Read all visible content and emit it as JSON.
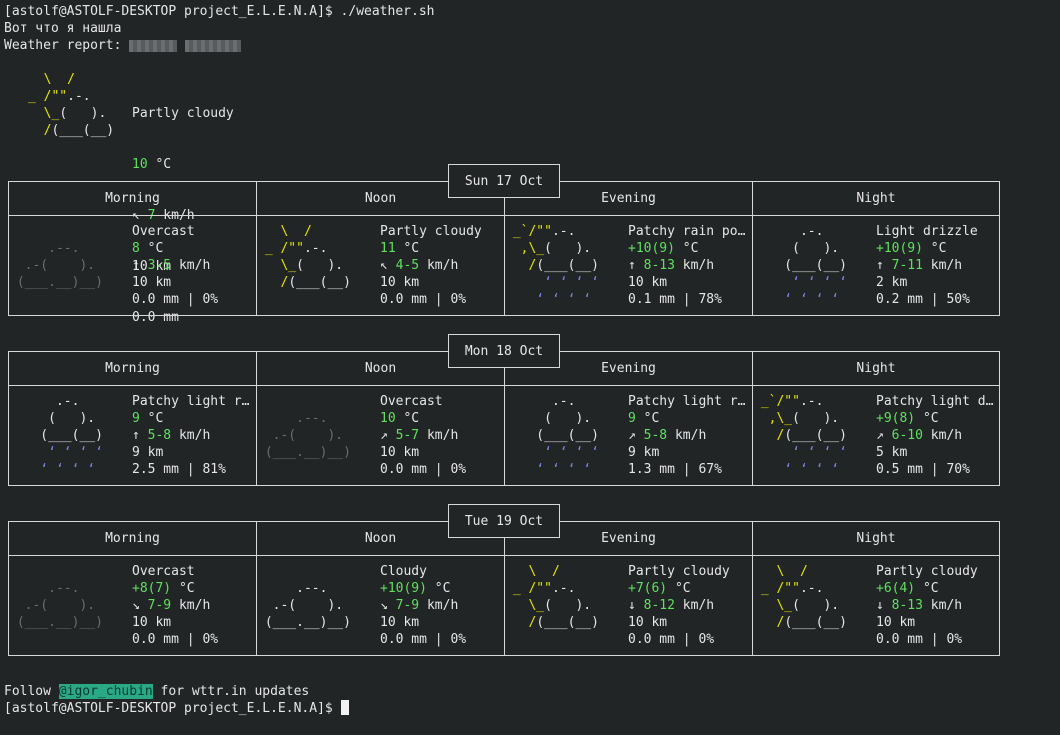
{
  "terminal": {
    "prompt_cmd": "[astolf@ASTOLF-DESKTOP project_E.L.E.N.A]$ ./weather.sh",
    "greeting": "Вот что я нашла",
    "report_label": "Weather report: ",
    "footer_prefix": "Follow ",
    "footer_handle": "@igor_chubin",
    "footer_suffix": " for wttr.in updates",
    "prompt_end": "[astolf@ASTOLF-DESKTOP project_E.L.E.N.A]$ "
  },
  "current": {
    "condition": "Partly cloudy",
    "temp": "10",
    "unit": " °C",
    "wind_dir": "↖",
    "wind": "7",
    "wind_unit": " km/h",
    "visibility": "10 km",
    "precip": "0.0 mm",
    "art": [
      "  \\  /      ",
      "_ /\"\".-.    ",
      "  \\_(   ).  ",
      "  /(___(__) "
    ]
  },
  "periods": [
    "Morning",
    "Noon",
    "Evening",
    "Night"
  ],
  "days": [
    {
      "label": "Sun 17 Oct",
      "forecasts": [
        {
          "condition": "Overcast",
          "temp": "8",
          "wind_dir": "↑",
          "wind": "3-5",
          "visibility": "10 km",
          "precip": "0.0 mm | 0%",
          "art_type": "overcast"
        },
        {
          "condition": "Partly cloudy",
          "temp": "11",
          "wind_dir": "↖",
          "wind": "4-5",
          "visibility": "10 km",
          "precip": "0.0 mm | 0%",
          "art_type": "partly"
        },
        {
          "condition": "Patchy rain po…",
          "temp": "+10(9)",
          "wind_dir": "↑",
          "wind": "8-13",
          "visibility": "10 km",
          "precip": "0.1 mm | 78%",
          "art_type": "patchyrain"
        },
        {
          "condition": "Light drizzle",
          "temp": "+10(9)",
          "wind_dir": "↑",
          "wind": "7-11",
          "visibility": "2 km",
          "precip": "0.2 mm | 50%",
          "art_type": "rain"
        }
      ]
    },
    {
      "label": "Mon 18 Oct",
      "forecasts": [
        {
          "condition": "Patchy light r…",
          "temp": "9",
          "wind_dir": "↑",
          "wind": "5-8",
          "visibility": "9 km",
          "precip": "2.5 mm | 81%",
          "art_type": "rain"
        },
        {
          "condition": "Overcast",
          "temp": "10",
          "wind_dir": "↗",
          "wind": "5-7",
          "visibility": "10 km",
          "precip": "0.0 mm | 0%",
          "art_type": "overcast"
        },
        {
          "condition": "Patchy light r…",
          "temp": "9",
          "wind_dir": "↗",
          "wind": "5-8",
          "visibility": "9 km",
          "precip": "1.3 mm | 67%",
          "art_type": "rain"
        },
        {
          "condition": "Patchy light d…",
          "temp": "+9(8)",
          "wind_dir": "↗",
          "wind": "6-10",
          "visibility": "5 km",
          "precip": "0.5 mm | 70%",
          "art_type": "patchyrain"
        }
      ]
    },
    {
      "label": "Tue 19 Oct",
      "forecasts": [
        {
          "condition": "Overcast",
          "temp": "+8(7)",
          "wind_dir": "↘",
          "wind": "7-9",
          "visibility": "10 km",
          "precip": "0.0 mm | 0%",
          "art_type": "overcast"
        },
        {
          "condition": "Cloudy",
          "temp": "+10(9)",
          "wind_dir": "↘",
          "wind": "7-9",
          "visibility": "10 km",
          "precip": "0.0 mm | 0%",
          "art_type": "cloudy"
        },
        {
          "condition": "Partly cloudy",
          "temp": "+7(6)",
          "wind_dir": "↓",
          "wind": "8-12",
          "visibility": "10 km",
          "precip": "0.0 mm | 0%",
          "art_type": "partly"
        },
        {
          "condition": "Partly cloudy",
          "temp": "+6(4)",
          "wind_dir": "↓",
          "wind": "8-13",
          "visibility": "10 km",
          "precip": "0.0 mm | 0%",
          "art_type": "partly"
        }
      ]
    }
  ],
  "art": {
    "overcast": [
      [
        {
          "t": "             ",
          "c": "dg"
        }
      ],
      [
        {
          "t": "     .--.    ",
          "c": "dg"
        }
      ],
      [
        {
          "t": "  .-(    ).  ",
          "c": "dg"
        }
      ],
      [
        {
          "t": " (___.__)__) ",
          "c": "dg"
        }
      ]
    ],
    "cloudy": [
      [
        {
          "t": "             ",
          "c": "wh"
        }
      ],
      [
        {
          "t": "     .--.    ",
          "c": "wh"
        }
      ],
      [
        {
          "t": "  .-(    ).  ",
          "c": "wh"
        }
      ],
      [
        {
          "t": " (___.__)__) ",
          "c": "wh"
        }
      ]
    ],
    "partly": [
      [
        {
          "t": "   \\  /      ",
          "c": "y"
        }
      ],
      [
        {
          "t": " _ /\"\"",
          "c": "y"
        },
        {
          "t": ".-.    ",
          "c": "wh"
        }
      ],
      [
        {
          "t": "   \\_",
          "c": "y"
        },
        {
          "t": "(   ).  ",
          "c": "wh"
        }
      ],
      [
        {
          "t": "   /",
          "c": "y"
        },
        {
          "t": "(___(__) ",
          "c": "wh"
        }
      ]
    ],
    "rain": [
      [
        {
          "t": "      .-.    ",
          "c": "wh"
        }
      ],
      [
        {
          "t": "     (   ).  ",
          "c": "wh"
        }
      ],
      [
        {
          "t": "    (___(__) ",
          "c": "wh"
        }
      ],
      [
        {
          "t": "     ‘ ‘ ‘ ‘ ",
          "c": "bl"
        }
      ],
      [
        {
          "t": "    ‘ ‘ ‘ ‘  ",
          "c": "bl"
        }
      ]
    ],
    "patchyrain": [
      [
        {
          "t": " _`/\"\"",
          "c": "y"
        },
        {
          "t": ".-.    ",
          "c": "wh"
        }
      ],
      [
        {
          "t": "  ,\\_",
          "c": "y"
        },
        {
          "t": "(   ).  ",
          "c": "wh"
        }
      ],
      [
        {
          "t": "   /",
          "c": "y"
        },
        {
          "t": "(___(__) ",
          "c": "wh"
        }
      ],
      [
        {
          "t": "     ‘ ‘ ‘ ‘ ",
          "c": "bl"
        }
      ],
      [
        {
          "t": "    ‘ ‘ ‘ ‘  ",
          "c": "bl"
        }
      ]
    ]
  }
}
